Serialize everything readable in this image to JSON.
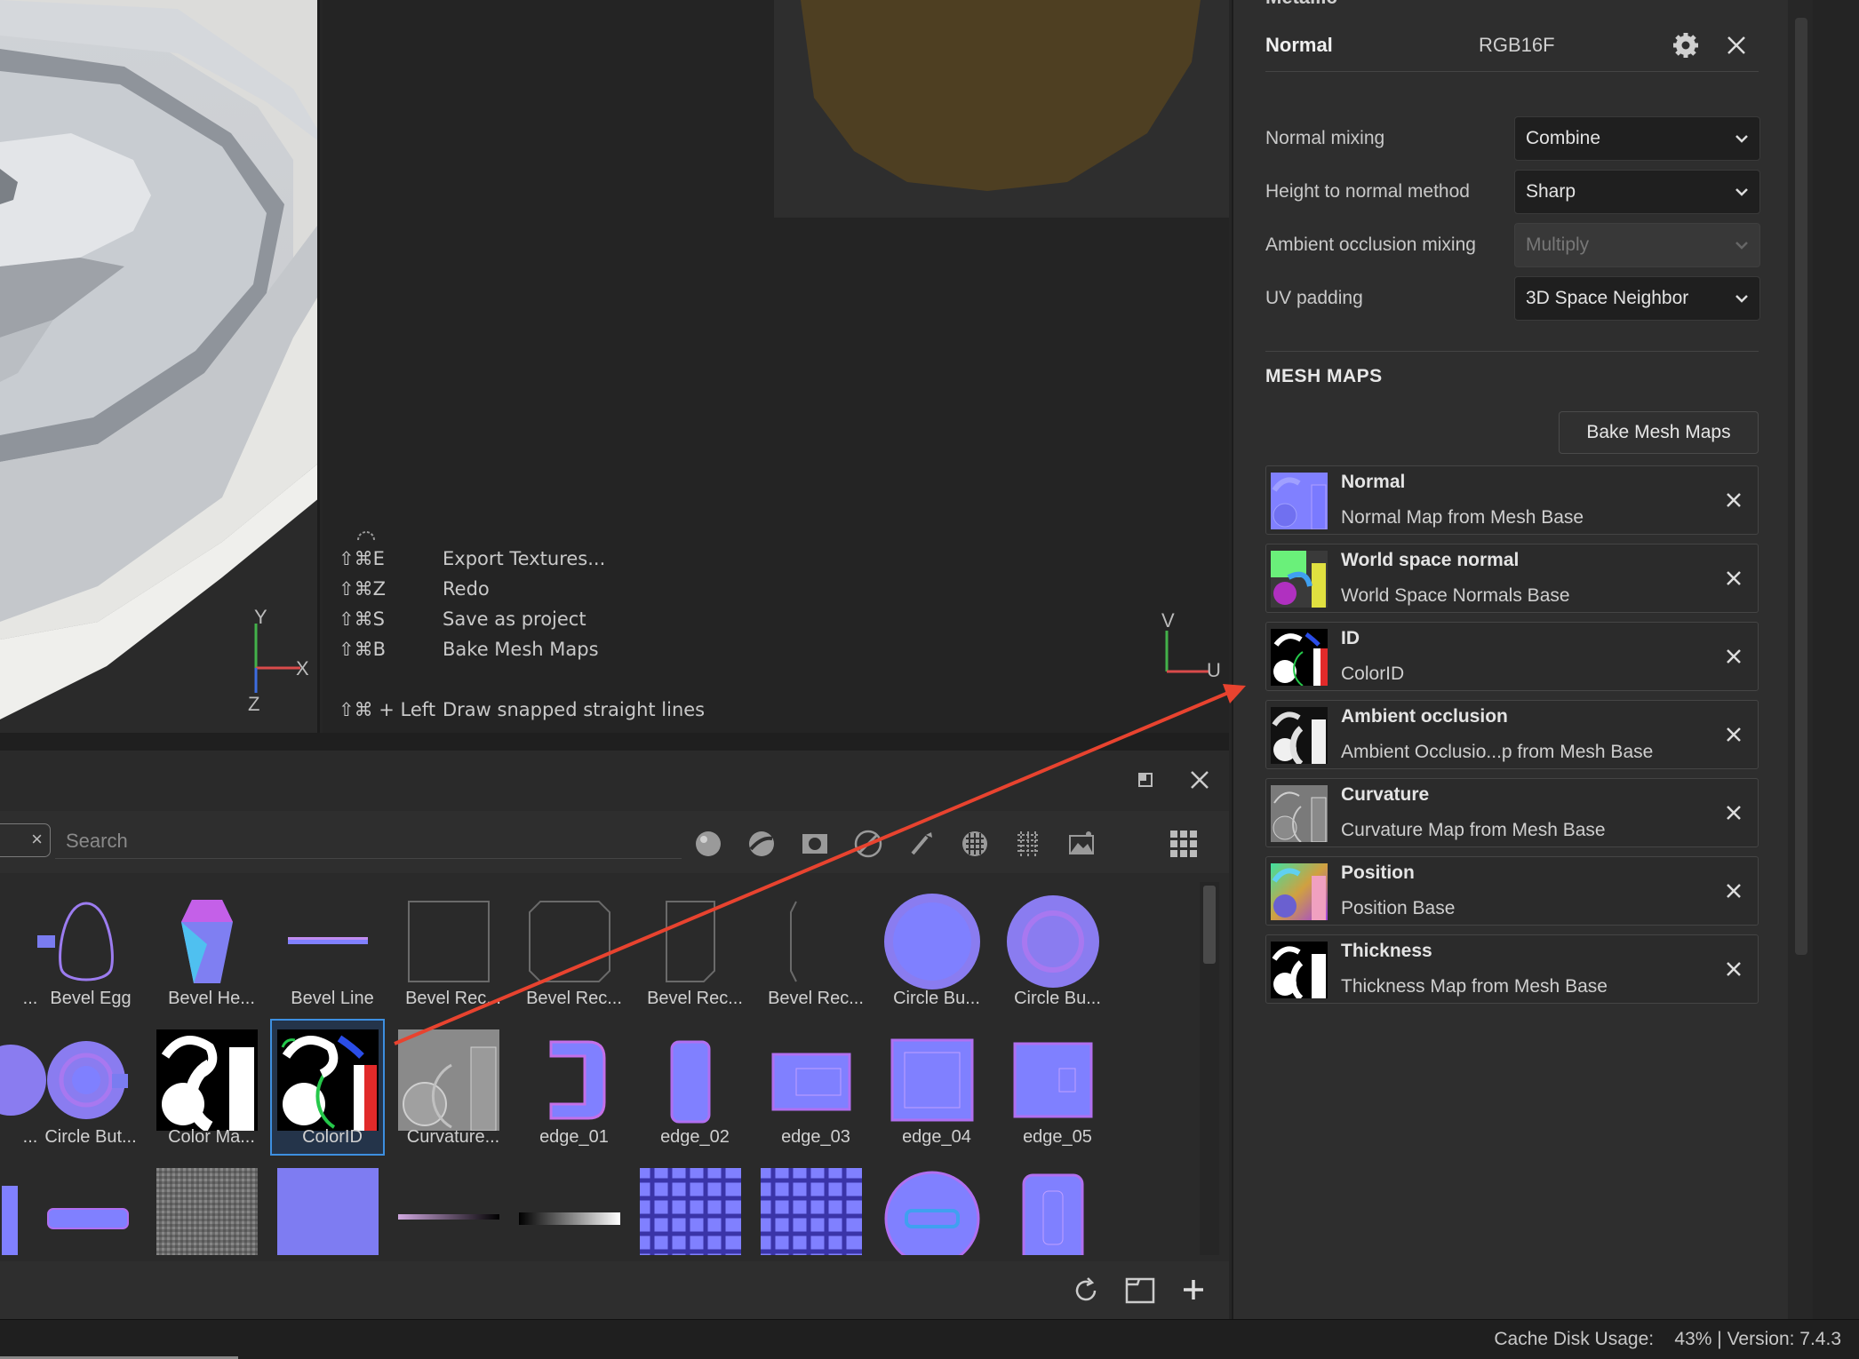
{
  "viewport3d": {
    "axis_y": "Y",
    "axis_x": "X",
    "axis_z": "Z"
  },
  "viewport2d": {
    "axis_v": "V",
    "axis_u": "U"
  },
  "shortcuts": [
    {
      "key": "⇧⌘E",
      "action": "Export Textures..."
    },
    {
      "key": "⇧⌘Z",
      "action": "Redo"
    },
    {
      "key": "⇧⌘S",
      "action": "Save as project"
    },
    {
      "key": "⇧⌘B",
      "action": "Bake Mesh Maps"
    }
  ],
  "shortcut_extra": {
    "key": "⇧⌘ + Left",
    "action": "Draw snapped straight lines"
  },
  "shelf": {
    "search_placeholder": "Search",
    "search_chip_close": "×",
    "filters": [
      "materials-filter",
      "smart-materials-filter",
      "masks-filter",
      "procedurals-filter",
      "brushes-filter",
      "alphas-filter",
      "textures-filter",
      "environments-filter"
    ],
    "row1": [
      "...",
      "Bevel Egg",
      "Bevel He...",
      "Bevel Line",
      "Bevel Rec...",
      "Bevel Rec...",
      "Bevel Rec...",
      "Bevel Rec...",
      "Circle Bu...",
      "Circle Bu..."
    ],
    "row2": [
      "...",
      "Circle But...",
      "Color Ma...",
      "ColorID",
      "Curvature...",
      "edge_01",
      "edge_02",
      "edge_03",
      "edge_04",
      "edge_05"
    ],
    "selected": "ColorID"
  },
  "texture_set": {
    "cut_title": "Metallic",
    "channel_name": "Normal",
    "channel_format": "RGB16F",
    "properties": [
      {
        "label": "Normal mixing",
        "value": "Combine",
        "disabled": false
      },
      {
        "label": "Height to normal method",
        "value": "Sharp",
        "disabled": false
      },
      {
        "label": "Ambient occlusion mixing",
        "value": "Multiply",
        "disabled": true
      },
      {
        "label": "UV padding",
        "value": "3D Space Neighbor",
        "disabled": false
      }
    ]
  },
  "mesh_maps": {
    "title": "MESH MAPS",
    "bake_button": "Bake Mesh Maps",
    "items": [
      {
        "name": "Normal",
        "source": "Normal Map from Mesh Base"
      },
      {
        "name": "World space normal",
        "source": "World Space Normals Base"
      },
      {
        "name": "ID",
        "source": "ColorID"
      },
      {
        "name": "Ambient occlusion",
        "source": "Ambient Occlusio...p from Mesh Base"
      },
      {
        "name": "Curvature",
        "source": "Curvature Map from Mesh Base"
      },
      {
        "name": "Position",
        "source": "Position Base"
      },
      {
        "name": "Thickness",
        "source": "Thickness Map from Mesh Base"
      }
    ]
  },
  "status": {
    "text": "Cache Disk Usage:    43% | Version: 7.4.3"
  },
  "colors": {
    "accent": "#3d8fe0",
    "annotation_arrow": "#e8432f",
    "normal_blue": "#8080ff"
  }
}
